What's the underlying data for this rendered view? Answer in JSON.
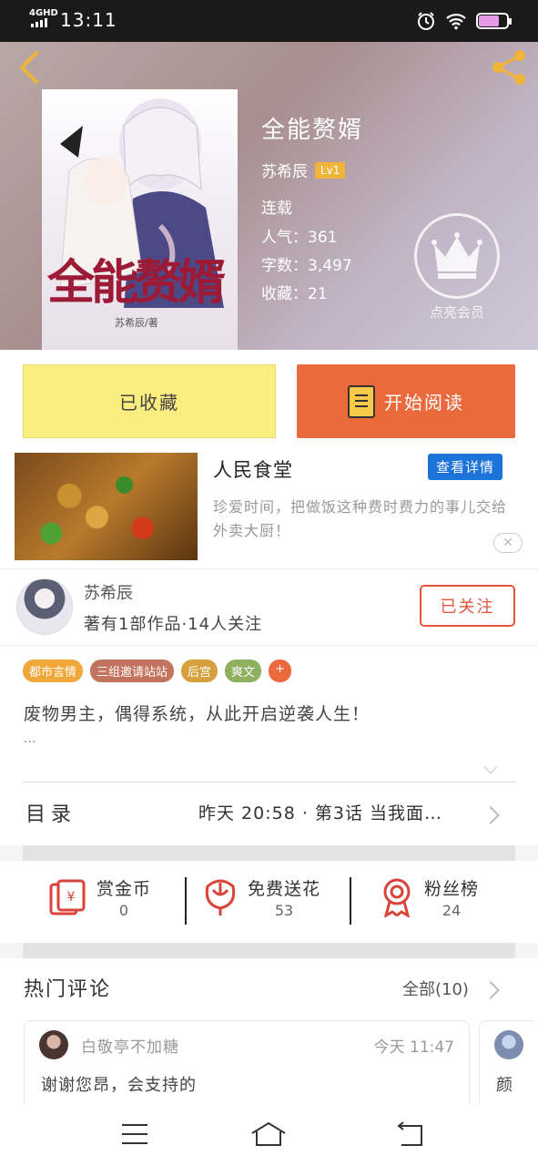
{
  "status_bar": {
    "network": "4GHD",
    "time": "13:11"
  },
  "book": {
    "title": "全能赘婿",
    "author": "苏希辰",
    "level": "Lv1",
    "status": "连载",
    "popularity": "人气：361",
    "word_count": "字数：3,497",
    "collections": "收藏：21",
    "cover_title": "全能赘婿",
    "cover_author": "苏希辰/著"
  },
  "vip": {
    "label": "点亮会员"
  },
  "actions": {
    "collected_label": "已收藏",
    "read_label": "开始阅读"
  },
  "ad": {
    "title": "人民食堂",
    "detail_label": "查看详情",
    "description": "珍爱时间，把做饭这种费时费力的事儿交给外卖大厨！",
    "close_symbol": "✕"
  },
  "author_section": {
    "name": "苏希辰",
    "info": "著有1部作品·14人关注",
    "follow_label": "已关注"
  },
  "tags": [
    {
      "label": "都市言情",
      "color": "#f0a83a"
    },
    {
      "label": "三组邀请站站",
      "color": "#c4735f"
    },
    {
      "label": "后宫",
      "color": "#d6a03c"
    },
    {
      "label": "爽文",
      "color": "#8fb061"
    },
    {
      "label": "+",
      "color": "#ec6a3e"
    }
  ],
  "synopsis": {
    "text": "废物男主，偶得系统，从此开启逆袭人生！",
    "more": "..."
  },
  "toc": {
    "label": "目录",
    "latest": "昨天 20:58 · 第3话 当我面…"
  },
  "stats": [
    {
      "label": "赏金币",
      "value": "0",
      "icon": "red-envelope-icon"
    },
    {
      "label": "免费送花",
      "value": "53",
      "icon": "flower-icon"
    },
    {
      "label": "粉丝榜",
      "value": "24",
      "icon": "medal-icon"
    }
  ],
  "comments": {
    "title": "热门评论",
    "all_label": "全部(10)",
    "items": [
      {
        "user": "白敬亭不加糖",
        "time": "今天 11:47",
        "text": "谢谢您昂，会支持的"
      },
      {
        "text": "颜"
      }
    ]
  },
  "colors": {
    "accent": "#ea6a3c",
    "collected_bg": "#fbee80",
    "link_blue": "#1c73d8",
    "icon_red": "#d9433a"
  }
}
